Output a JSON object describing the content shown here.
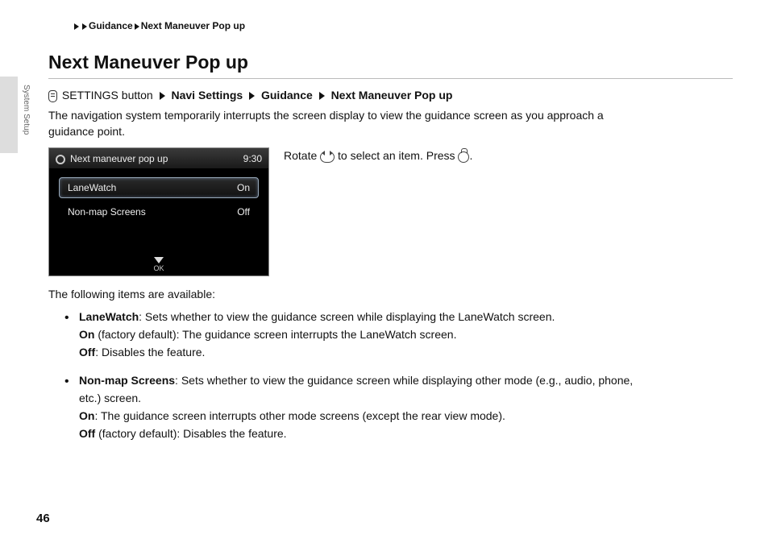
{
  "breadcrumb": {
    "a": "Guidance",
    "b": "Next Maneuver Pop up"
  },
  "title": "Next Maneuver Pop up",
  "sideLabel": "System Setup",
  "path": {
    "p1": "SETTINGS button",
    "p2": "Navi Settings",
    "p3": "Guidance",
    "p4": "Next Maneuver Pop up"
  },
  "intro": "The navigation system temporarily interrupts the screen display to view the guidance screen as you approach a guidance point.",
  "device": {
    "title": "Next maneuver pop up",
    "time": "9:30",
    "rows": [
      {
        "label": "LaneWatch",
        "value": "On",
        "selected": true
      },
      {
        "label": "Non-map Screens",
        "value": "Off",
        "selected": false
      }
    ],
    "ok": "OK"
  },
  "rotateLine": {
    "a": "Rotate ",
    "b": " to select an item. Press ",
    "c": "."
  },
  "availableLine": "The following items are available:",
  "items": [
    {
      "name": "LaneWatch",
      "desc": ": Sets whether to view the guidance screen while displaying the LaneWatch screen.",
      "onLabel": "On",
      "onText": " (factory default): The guidance screen interrupts the LaneWatch screen.",
      "offLabel": "Off",
      "offText": ": Disables the feature."
    },
    {
      "name": "Non-map Screens",
      "desc": ": Sets whether to view the guidance screen while displaying other mode (e.g., audio, phone, etc.) screen.",
      "onLabel": "On",
      "onText": ": The guidance screen interrupts other mode screens (except the rear view mode).",
      "offLabel": "Off",
      "offText": " (factory default): Disables the feature."
    }
  ],
  "pageNumber": "46"
}
